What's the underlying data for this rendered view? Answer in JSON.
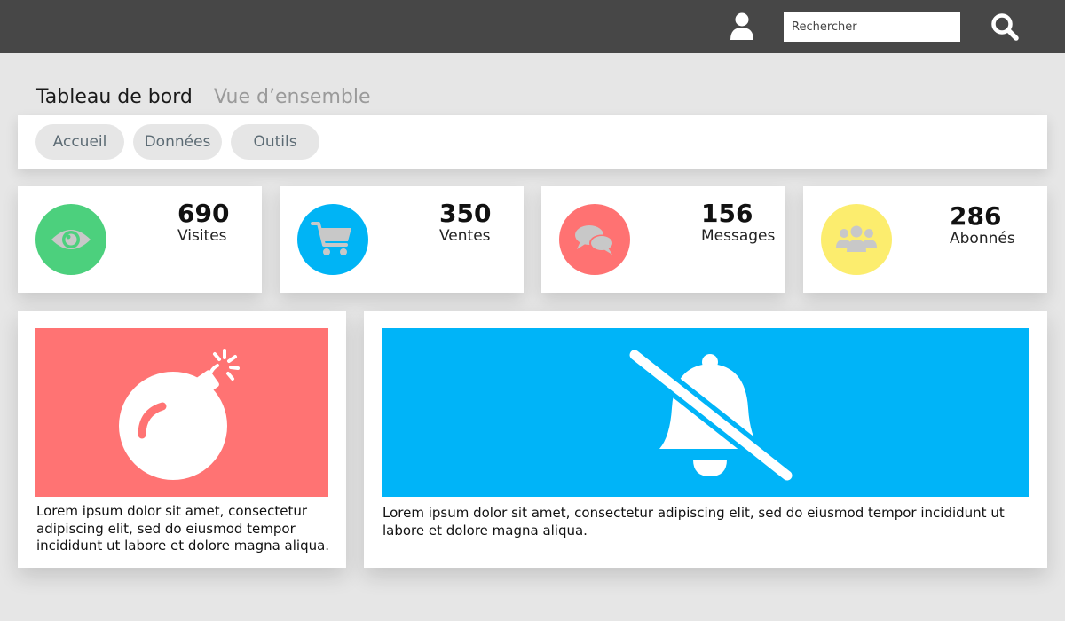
{
  "topbar": {
    "search_placeholder": "Rechercher",
    "user_icon": "user-icon",
    "search_icon": "magnifier-icon",
    "color": "#474747"
  },
  "page": {
    "title": "Tableau de bord",
    "subtitle": "Vue d’ensemble"
  },
  "tabs": [
    {
      "label": "Accueil"
    },
    {
      "label": "Données"
    },
    {
      "label": "Outils"
    }
  ],
  "stats": [
    {
      "value": "690",
      "label": "Visites",
      "icon": "eye-icon",
      "color": "#4cd07d"
    },
    {
      "value": "350",
      "label": "Ventes",
      "icon": "cart-icon",
      "color": "#00b4f5"
    },
    {
      "value": "156",
      "label": "Messages",
      "icon": "chat-icon",
      "color": "#ff7272"
    },
    {
      "value": "286",
      "label": "Abonnés",
      "icon": "group-icon",
      "color": "#fced6e"
    }
  ],
  "cards": [
    {
      "icon": "bomb-icon",
      "color": "#ff7373",
      "text": "Lorem ipsum dolor sit amet, consectetur adipiscing elit, sed do eiusmod tempor incididunt ut labore et dolore magna aliqua."
    },
    {
      "icon": "bell-slash-icon",
      "color": "#00b4f8",
      "text": "Lorem ipsum dolor sit amet, consectetur adipiscing elit, sed do eiusmod tempor incididunt ut labore et dolore magna aliqua."
    }
  ]
}
